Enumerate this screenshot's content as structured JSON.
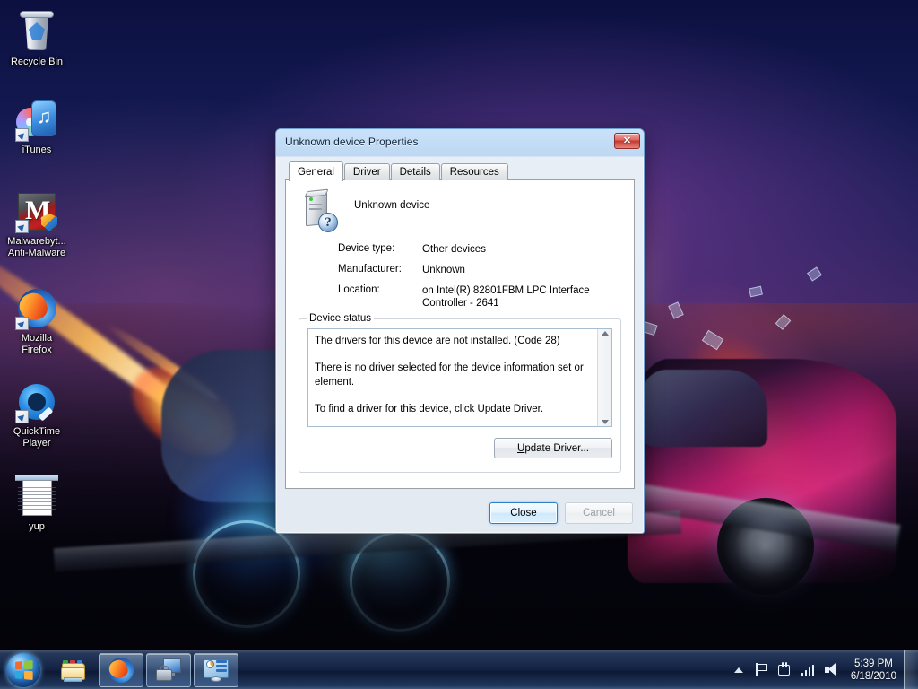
{
  "desktop": {
    "icons": [
      {
        "name": "recycle-bin",
        "label": "Recycle Bin"
      },
      {
        "name": "itunes",
        "label": "iTunes"
      },
      {
        "name": "malwarebytes",
        "label": "Malwarebyt...\nAnti-Malware"
      },
      {
        "name": "mozilla-firefox",
        "label": "Mozilla\nFirefox"
      },
      {
        "name": "quicktime-player",
        "label": "QuickTime\nPlayer"
      },
      {
        "name": "yup-document",
        "label": "yup"
      }
    ]
  },
  "dialog": {
    "title": "Unknown device Properties",
    "close_button": "✕",
    "tabs": [
      {
        "label": "General",
        "active": true
      },
      {
        "label": "Driver",
        "active": false
      },
      {
        "label": "Details",
        "active": false
      },
      {
        "label": "Resources",
        "active": false
      }
    ],
    "device": {
      "icon": "unknown-device-icon",
      "name": "Unknown device",
      "badge": "?",
      "fields": [
        {
          "key": "Device type:",
          "value": "Other devices"
        },
        {
          "key": "Manufacturer:",
          "value": "Unknown"
        },
        {
          "key": "Location:",
          "value": "on Intel(R) 82801FBM LPC Interface Controller - 2641"
        }
      ]
    },
    "status": {
      "legend": "Device status",
      "lines": [
        "The drivers for this device are not installed. (Code 28)",
        "There is no driver selected for the device information set or element.",
        "To find a driver for this device, click Update Driver."
      ]
    },
    "update_driver": {
      "mnemonic": "U",
      "rest": "pdate Driver..."
    },
    "footer": {
      "close": "Close",
      "cancel": "Cancel"
    }
  },
  "taskbar": {
    "start": "start-orb",
    "buttons": [
      {
        "name": "taskbar-explorer",
        "state": "pinned"
      },
      {
        "name": "taskbar-firefox",
        "state": "running"
      },
      {
        "name": "taskbar-device-manager",
        "state": "running"
      },
      {
        "name": "taskbar-control-panel",
        "state": "running"
      }
    ],
    "tray": [
      {
        "name": "show-hidden-icons"
      },
      {
        "name": "action-center-flag"
      },
      {
        "name": "network-hand"
      },
      {
        "name": "network-signal"
      },
      {
        "name": "volume"
      }
    ],
    "clock": {
      "time": "5:39 PM",
      "date": "6/18/2010"
    }
  },
  "colors": {
    "accent": "#2c80c8",
    "titlebar": "#bad6f2",
    "close_red": "#c33a31",
    "panel": "#ffffff"
  }
}
